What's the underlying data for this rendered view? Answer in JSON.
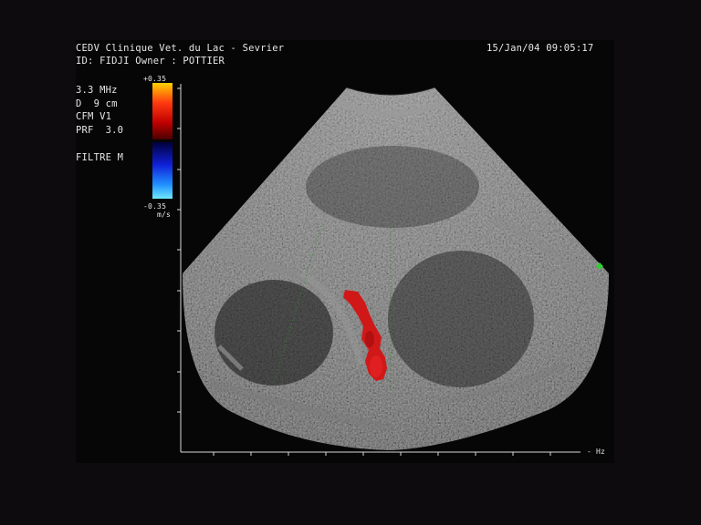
{
  "header": {
    "clinic": "CEDV Clinique Vet. du Lac - Sevrier",
    "patient_line": "ID: FIDJI Owner : POTTIER",
    "datetime": "15/Jan/04 09:05:17"
  },
  "parameters": {
    "frequency": "3.3 MHz",
    "depth": "D  9 cm",
    "mode": "CFM V1",
    "prf": "PRF  3.0",
    "filter": "FILTRE M"
  },
  "color_scale": {
    "max": "+0.35",
    "min": "-0.35",
    "unit": "m/s",
    "colors": {
      "positive_top": "#ffd000",
      "positive_mid": "#e01010",
      "positive_low": "#6a0000",
      "negative_low": "#00004a",
      "negative_mid": "#1020e0",
      "negative_top": "#60e0ff"
    }
  },
  "axis": {
    "x_unit": "- Hz"
  },
  "colors": {
    "background": "#0d0b0e",
    "focus_marker": "#30d030",
    "doppler_flow": "#d01818"
  }
}
